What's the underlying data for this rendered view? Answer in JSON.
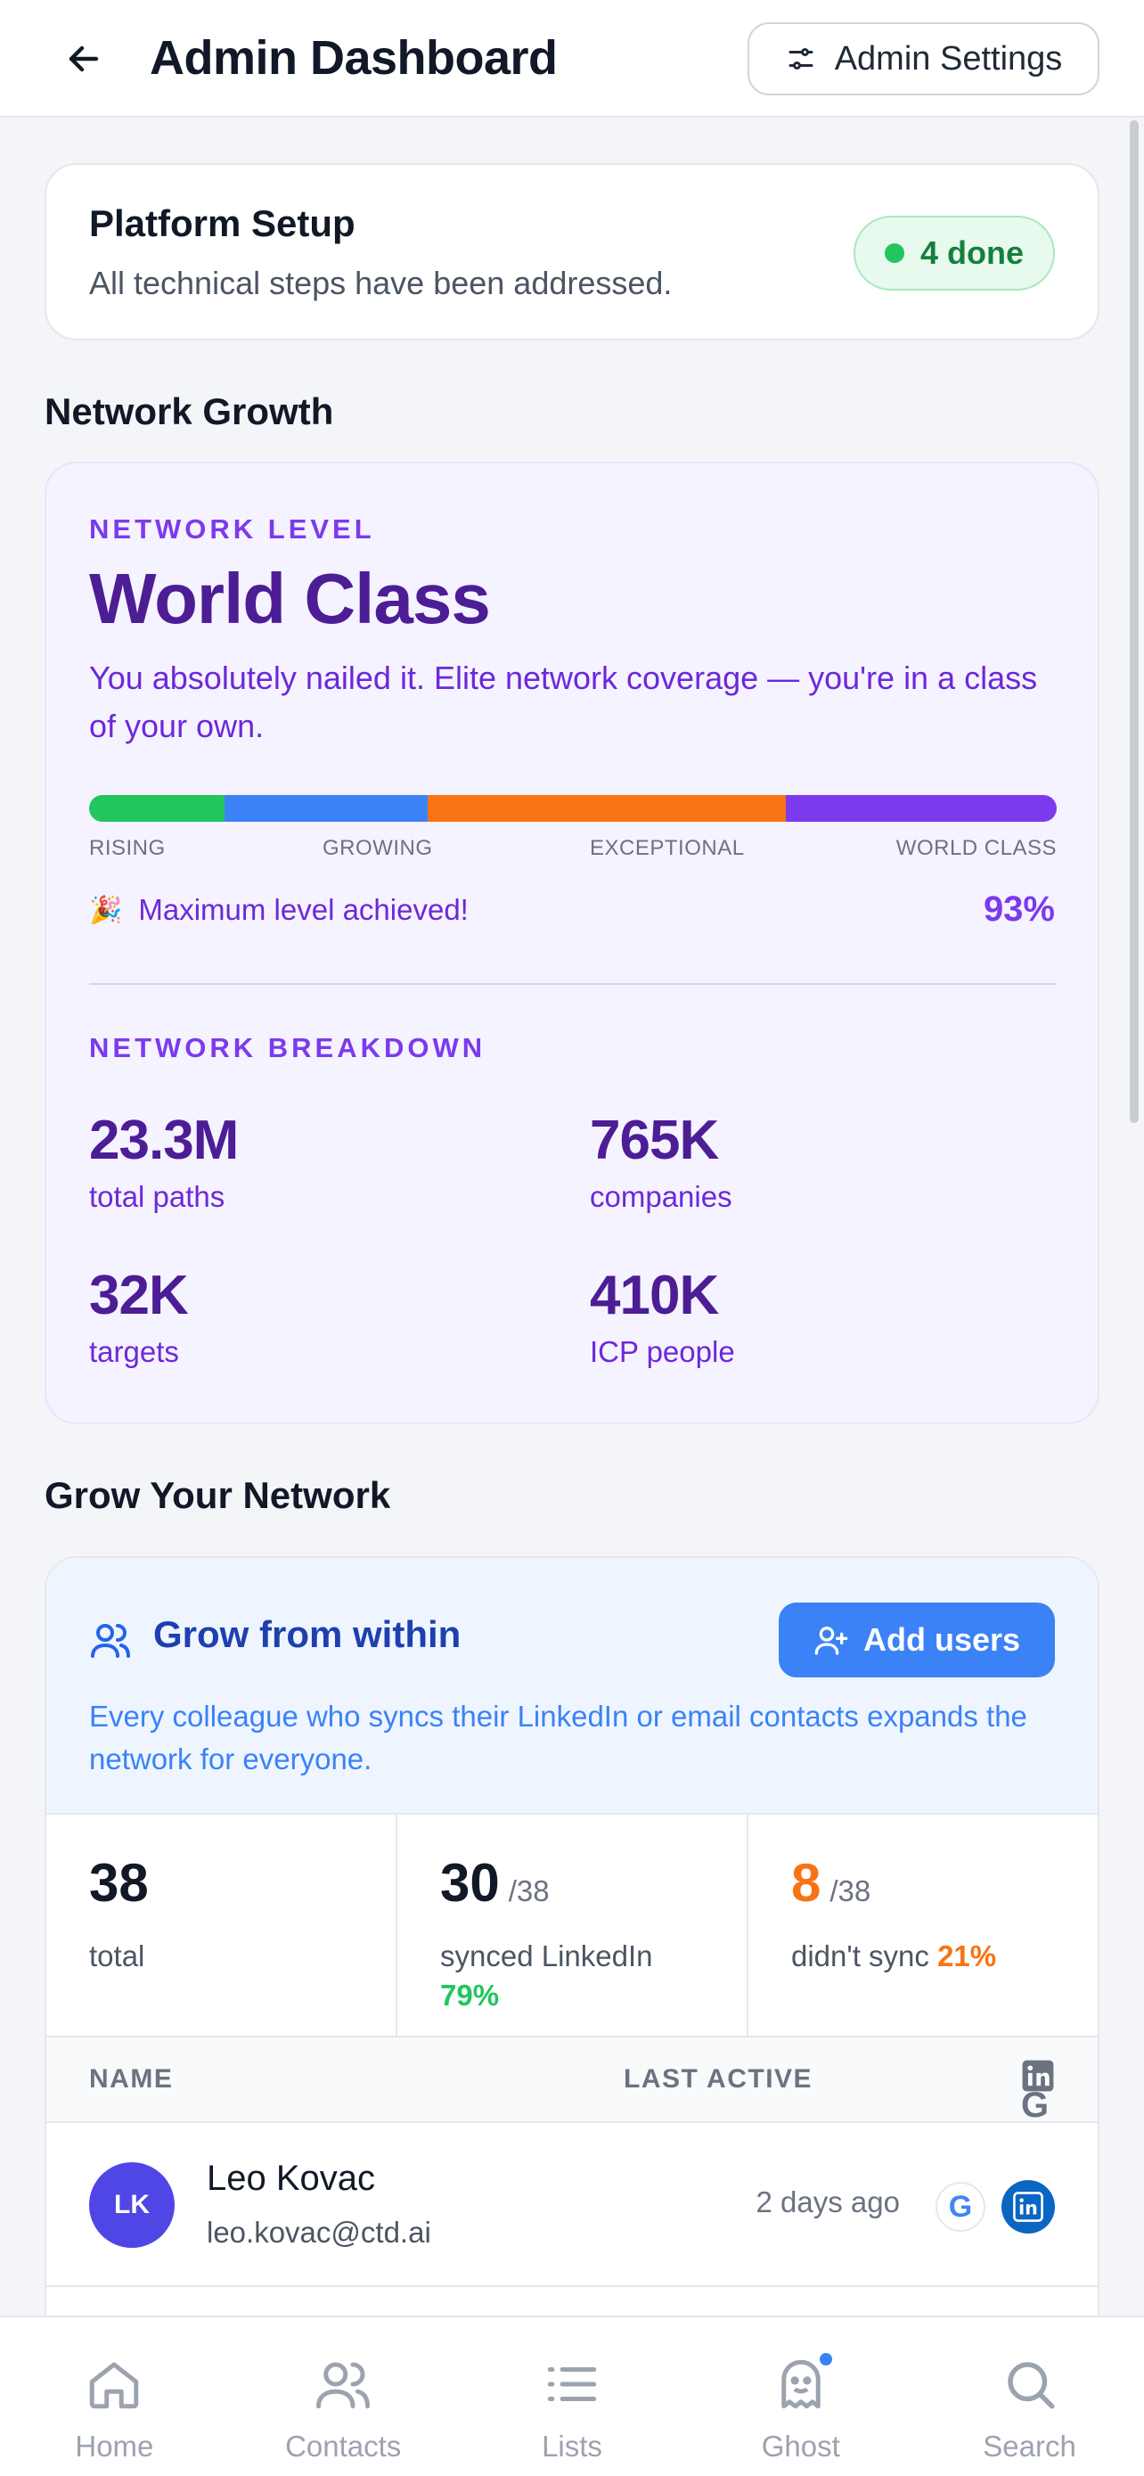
{
  "header": {
    "title": "Admin Dashboard",
    "settings_label": "Admin Settings"
  },
  "setup": {
    "title": "Platform Setup",
    "subtitle": "All technical steps have been addressed.",
    "badge": "4 done"
  },
  "network_growth": {
    "section_title": "Network Growth",
    "eyebrow": "NETWORK LEVEL",
    "level": "World Class",
    "description": "You absolutely nailed it. Elite network coverage — you're in a class of your own.",
    "tiers": [
      "RISING",
      "GROWING",
      "EXCEPTIONAL",
      "WORLD CLASS"
    ],
    "tier_colors": [
      "#22c55e",
      "#3b82f6",
      "#f97316",
      "#7c3aed"
    ],
    "achieved_text": "Maximum level achieved!",
    "achieved_icon": "party-popper-icon",
    "percent": "93%",
    "breakdown_title": "NETWORK BREAKDOWN",
    "stats": [
      {
        "value": "23.3M",
        "label": "total paths"
      },
      {
        "value": "765K",
        "label": "companies"
      },
      {
        "value": "32K",
        "label": "targets"
      },
      {
        "value": "410K",
        "label": "ICP people"
      }
    ]
  },
  "grow": {
    "section_title": "Grow Your Network",
    "title": "Grow from within",
    "add_label": "Add users",
    "description": "Every colleague who syncs their LinkedIn or email contacts expands the network for everyone.",
    "counts": [
      {
        "value": "38",
        "of": "",
        "label": "total",
        "pct": ""
      },
      {
        "value": "30",
        "of": "/38",
        "label": "synced LinkedIn",
        "pct": "79%"
      },
      {
        "value": "8",
        "of": "/38",
        "label": "didn't sync",
        "pct": "21%"
      }
    ],
    "table": {
      "col_name": "NAME",
      "col_active": "LAST ACTIVE"
    },
    "rows": [
      {
        "initials": "LK",
        "name": "Leo Kovac",
        "email": "leo.kovac@ctd.ai",
        "last_active": "2 days ago"
      }
    ]
  },
  "nav": {
    "items": [
      {
        "label": "Home",
        "icon": "home-icon"
      },
      {
        "label": "Contacts",
        "icon": "contacts-icon"
      },
      {
        "label": "Lists",
        "icon": "list-icon"
      },
      {
        "label": "Ghost",
        "icon": "ghost-icon"
      },
      {
        "label": "Search",
        "icon": "search-icon"
      }
    ]
  }
}
